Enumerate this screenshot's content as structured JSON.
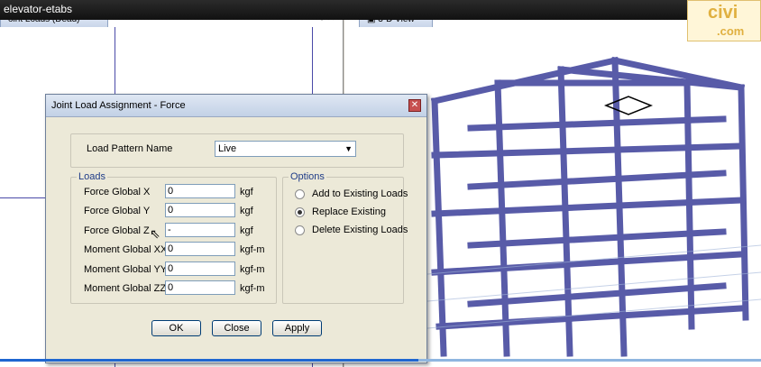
{
  "video": {
    "title": "elevator-etabs"
  },
  "left_pane": {
    "tab_label": "oint Loads (Dead)",
    "controls": "▾ ✕"
  },
  "right_pane": {
    "tab_label": "3-D View"
  },
  "logo": {
    "text_top": "civi",
    "text_bottom": ".com"
  },
  "dialog": {
    "title": "Joint Load Assignment - Force",
    "load_pattern_label": "Load Pattern Name",
    "load_pattern_value": "Live",
    "loads_group": "Loads",
    "options_group": "Options",
    "fields": [
      {
        "label": "Force Global X",
        "value": "0",
        "unit": "kgf"
      },
      {
        "label": "Force Global Y",
        "value": "0",
        "unit": "kgf"
      },
      {
        "label": "Force Global Z",
        "value": "-",
        "unit": "kgf"
      },
      {
        "label": "Moment Global XX",
        "value": "0",
        "unit": "kgf-m"
      },
      {
        "label": "Moment Global YY",
        "value": "0",
        "unit": "kgf-m"
      },
      {
        "label": "Moment Global ZZ",
        "value": "0",
        "unit": "kgf-m"
      }
    ],
    "options": [
      {
        "label": "Add to Existing Loads",
        "selected": false
      },
      {
        "label": "Replace Existing",
        "selected": true
      },
      {
        "label": "Delete Existing Loads",
        "selected": false
      }
    ],
    "buttons": {
      "ok": "OK",
      "close": "Close",
      "apply": "Apply"
    }
  },
  "video_progress": 0.55,
  "colors": {
    "frame": "#3b3f9a",
    "accent": "#1f3c88"
  }
}
